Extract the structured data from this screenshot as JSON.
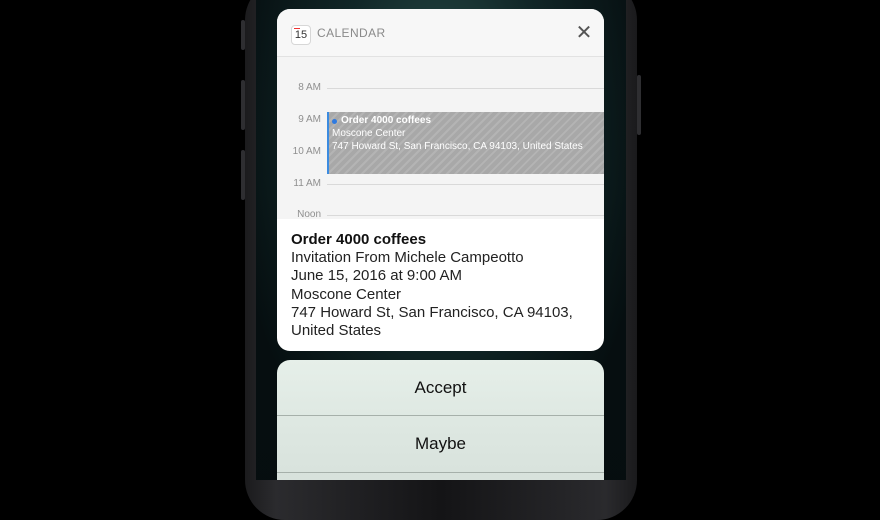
{
  "notification": {
    "app_name": "CALENDAR",
    "app_icon_day": "15",
    "close_icon": "close-icon",
    "timeline": {
      "hours": [
        "8 AM",
        "9 AM",
        "10 AM",
        "11 AM",
        "Noon"
      ],
      "event": {
        "title": "Order 4000 coffees",
        "location": "Moscone Center",
        "address": "747 Howard St, San Francisco, CA  94103, United States",
        "color": "#3b8be0"
      }
    },
    "details": {
      "title": "Order 4000 coffees",
      "invitation": "Invitation From Michele Campeotto",
      "datetime": "June 15, 2016 at 9:00 AM",
      "location": "Moscone Center",
      "address_line1": "747 Howard St, San Francisco, CA  94103,",
      "address_line2": "United States"
    }
  },
  "actions": {
    "accept": "Accept",
    "maybe": "Maybe"
  }
}
